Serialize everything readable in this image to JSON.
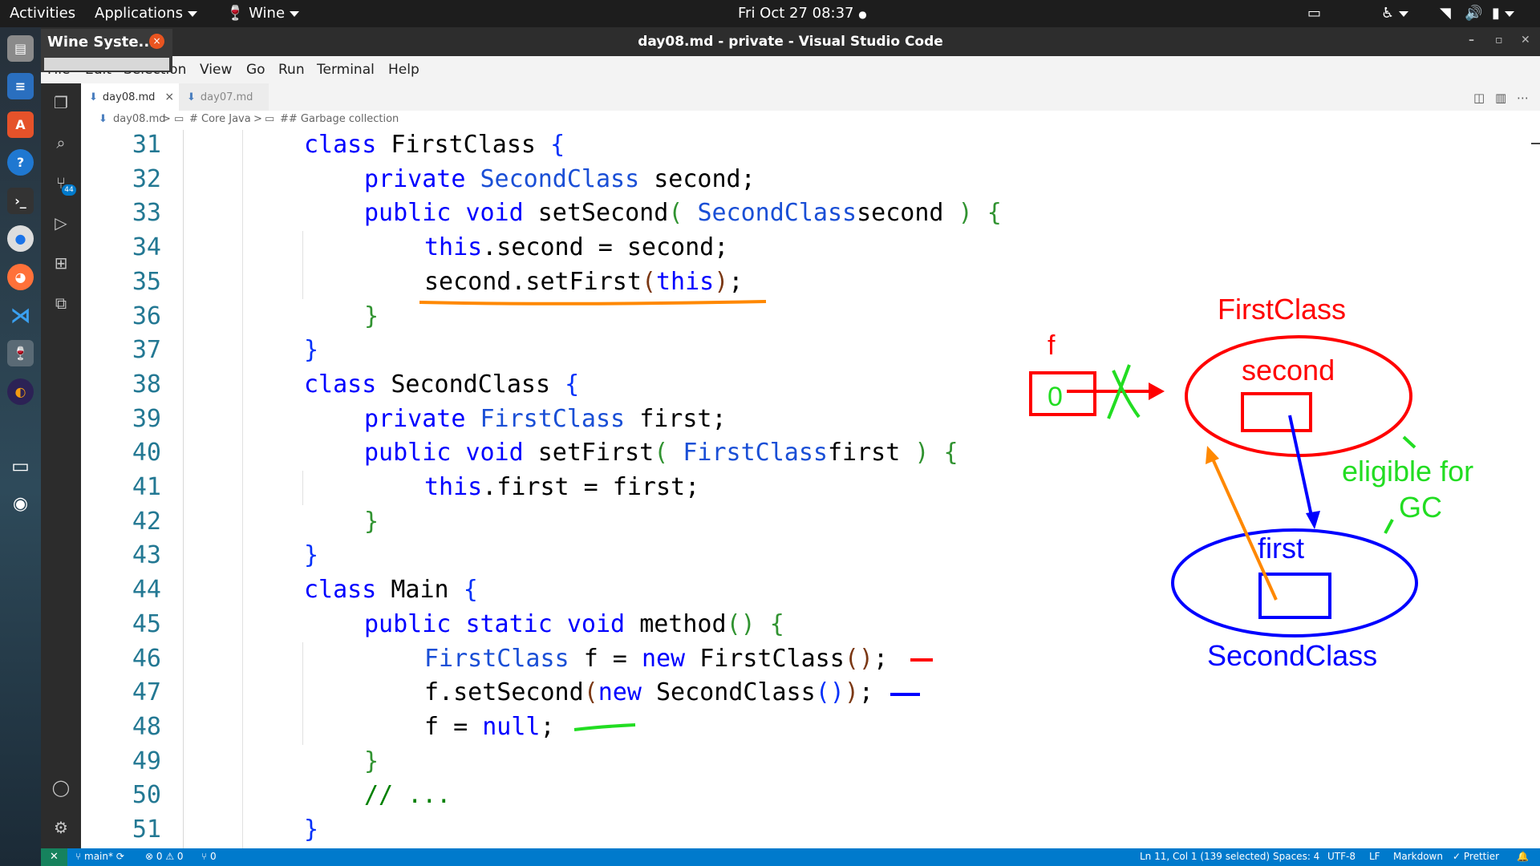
{
  "topbar": {
    "activities": "Activities",
    "applications": "Applications",
    "wine": "Wine",
    "clock": "Fri Oct 27  08:37",
    "clock_dot": "●"
  },
  "wine_popup": {
    "title": "Wine Syste...",
    "close": "×"
  },
  "window": {
    "title": "day08.md - private - Visual Studio Code",
    "controls": [
      "–",
      "▫",
      "✕"
    ]
  },
  "menubar": [
    "File",
    "Edit",
    "Selection",
    "View",
    "Go",
    "Run",
    "Terminal",
    "Help"
  ],
  "tabs": [
    {
      "label": "day08.md",
      "active": true
    },
    {
      "label": "day07.md",
      "active": false
    }
  ],
  "breadcrumb": {
    "file": "day08.md",
    "h1": "# Core Java",
    "h2": "## Garbage collection",
    "sep": ">"
  },
  "activity_badge": "44",
  "editor": {
    "lines": [
      {
        "n": "31",
        "indent": 0
      },
      {
        "n": "32",
        "indent": 1
      },
      {
        "n": "33",
        "indent": 1
      },
      {
        "n": "34",
        "indent": 2
      },
      {
        "n": "35",
        "indent": 2
      },
      {
        "n": "36",
        "indent": 1
      },
      {
        "n": "37",
        "indent": 0
      },
      {
        "n": "38",
        "indent": 0
      },
      {
        "n": "39",
        "indent": 1
      },
      {
        "n": "40",
        "indent": 1
      },
      {
        "n": "41",
        "indent": 2
      },
      {
        "n": "42",
        "indent": 1
      },
      {
        "n": "43",
        "indent": 0
      },
      {
        "n": "44",
        "indent": 0
      },
      {
        "n": "45",
        "indent": 1
      },
      {
        "n": "46",
        "indent": 2
      },
      {
        "n": "47",
        "indent": 2
      },
      {
        "n": "48",
        "indent": 2
      },
      {
        "n": "49",
        "indent": 1
      },
      {
        "n": "50",
        "indent": 1
      },
      {
        "n": "51",
        "indent": 0
      }
    ],
    "code": {
      "l31": [
        "class",
        "FirstClass",
        "{"
      ],
      "l32": [
        "private",
        "SecondClass",
        "second;"
      ],
      "l33": [
        "public",
        "void",
        "setSecond",
        "(",
        "SecondClass",
        "second",
        ")",
        "{"
      ],
      "l34": [
        "this",
        ".second = second;"
      ],
      "l35": [
        "second.setFirst",
        "(",
        "this",
        ")",
        ";"
      ],
      "l36": [
        "}"
      ],
      "l37": [
        "}"
      ],
      "l38": [
        "class",
        "SecondClass",
        "{"
      ],
      "l39": [
        "private",
        "FirstClass",
        "first;"
      ],
      "l40": [
        "public",
        "void",
        "setFirst",
        "(",
        "FirstClass",
        "first",
        ")",
        "{"
      ],
      "l41": [
        "this",
        ".first = first;"
      ],
      "l42": [
        "}"
      ],
      "l43": [
        "}"
      ],
      "l44": [
        "class",
        "Main",
        "{"
      ],
      "l45": [
        "public",
        "static",
        "void",
        "method",
        "()",
        "{"
      ],
      "l46": [
        "FirstClass",
        "f =",
        "new",
        "FirstClass",
        "()",
        ";"
      ],
      "l47": [
        "f.setSecond",
        "(",
        "new",
        "SecondClass",
        "()",
        ")",
        ";"
      ],
      "l48": [
        "f =",
        "null",
        ";"
      ],
      "l49": [
        "}"
      ],
      "l50": [
        "// ..."
      ],
      "l51": [
        "}"
      ]
    }
  },
  "annotations": {
    "firstclass_label": "FirstClass",
    "second_label": "second",
    "f_label": "f",
    "f_value": "0",
    "eligible_label": "eligible for",
    "gc_label": "GC",
    "first_label": "first",
    "secondclass_label": "SecondClass",
    "colors": {
      "red": "#ff0000",
      "blue": "#0000ff",
      "green": "#22dd22",
      "orange": "#ff8800"
    }
  },
  "statusbar": {
    "branch": "main*",
    "problems": "⊗ 0 ⚠ 0",
    "ports": "⑂ 0",
    "position": "Ln 11, Col 1 (139 selected)",
    "spaces": "Spaces: 4",
    "encoding": "UTF-8",
    "eol": "LF",
    "language": "Markdown",
    "prettier": "✓ Prettier",
    "bell": "🔔"
  },
  "dock_icons": [
    "files-icon",
    "writer-icon",
    "software-icon",
    "help-icon",
    "terminal-icon",
    "chrome-icon",
    "firefox-icon",
    "vscode-icon",
    "wine-icon",
    "eclipse-icon",
    "display-icon",
    "camera-icon"
  ],
  "accent": "#007acc"
}
